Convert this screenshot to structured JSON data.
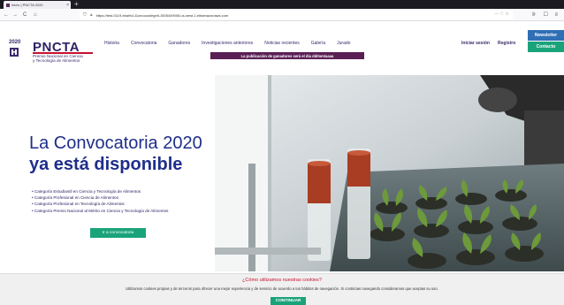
{
  "browser": {
    "tab_title": "Inicio | PNCTA 2020",
    "url_main": "https://test-0119-ebahtd-11ceooooliegelt-1505449008.us-west-1.elbamazonaws.com",
    "back": "←",
    "forward": "→",
    "reload": "C",
    "home": "⌂",
    "newtab": "+",
    "right_icons": "··· ♡ ☆",
    "toolbar_icons": "⊪ ☐ ≡"
  },
  "site": {
    "logo_year": "2020",
    "logo_title": "PNCTA",
    "logo_sub_1": "Premio Nacional en Ciencia",
    "logo_sub_2": "y Tecnología de Alimentos",
    "nav": [
      "Historia",
      "Convocatoria",
      "Ganadores",
      "Investigaciones anteriores",
      "Noticias recientes",
      "Galería",
      "Jurado"
    ],
    "login": "Iniciar sesión",
    "register": "Registro",
    "newsletter": "Newsletter",
    "contacto": "Contacto",
    "announcement": "La publicación de ganadores será el día dd/mm/aaaa"
  },
  "hero": {
    "headline_1": "La Convocatoria 2020",
    "headline_2": "ya está disponible",
    "list": [
      "Categoría Estudiantil en Ciencia y Tecnología de Alimentos",
      "Categoría Profesional en Ciencia de Alimentos",
      "Categoría Profesional en Tecnología de Alimentos",
      "Categoría Premio Nacional al Mérito en Ciencia y Tecnología de Alimentos"
    ],
    "cta": "Ir a convocatoria"
  },
  "cookie": {
    "title": "¿Cómo utilizamos nuestras cookies?",
    "text": "Utilizamos cookies propias y de terceros para ofrecer una mejor experiencia y de servicio de acuerdo a tus hábitos de navegación. Si continúas navegando consideramos que aceptas su uso.",
    "button": "CONTINUAR"
  },
  "colors": {
    "brand": "#2d2366",
    "accent_red": "#c8102e",
    "green": "#1aa37a",
    "blue": "#2f6fb5",
    "purple_bar": "#5a1f55"
  }
}
